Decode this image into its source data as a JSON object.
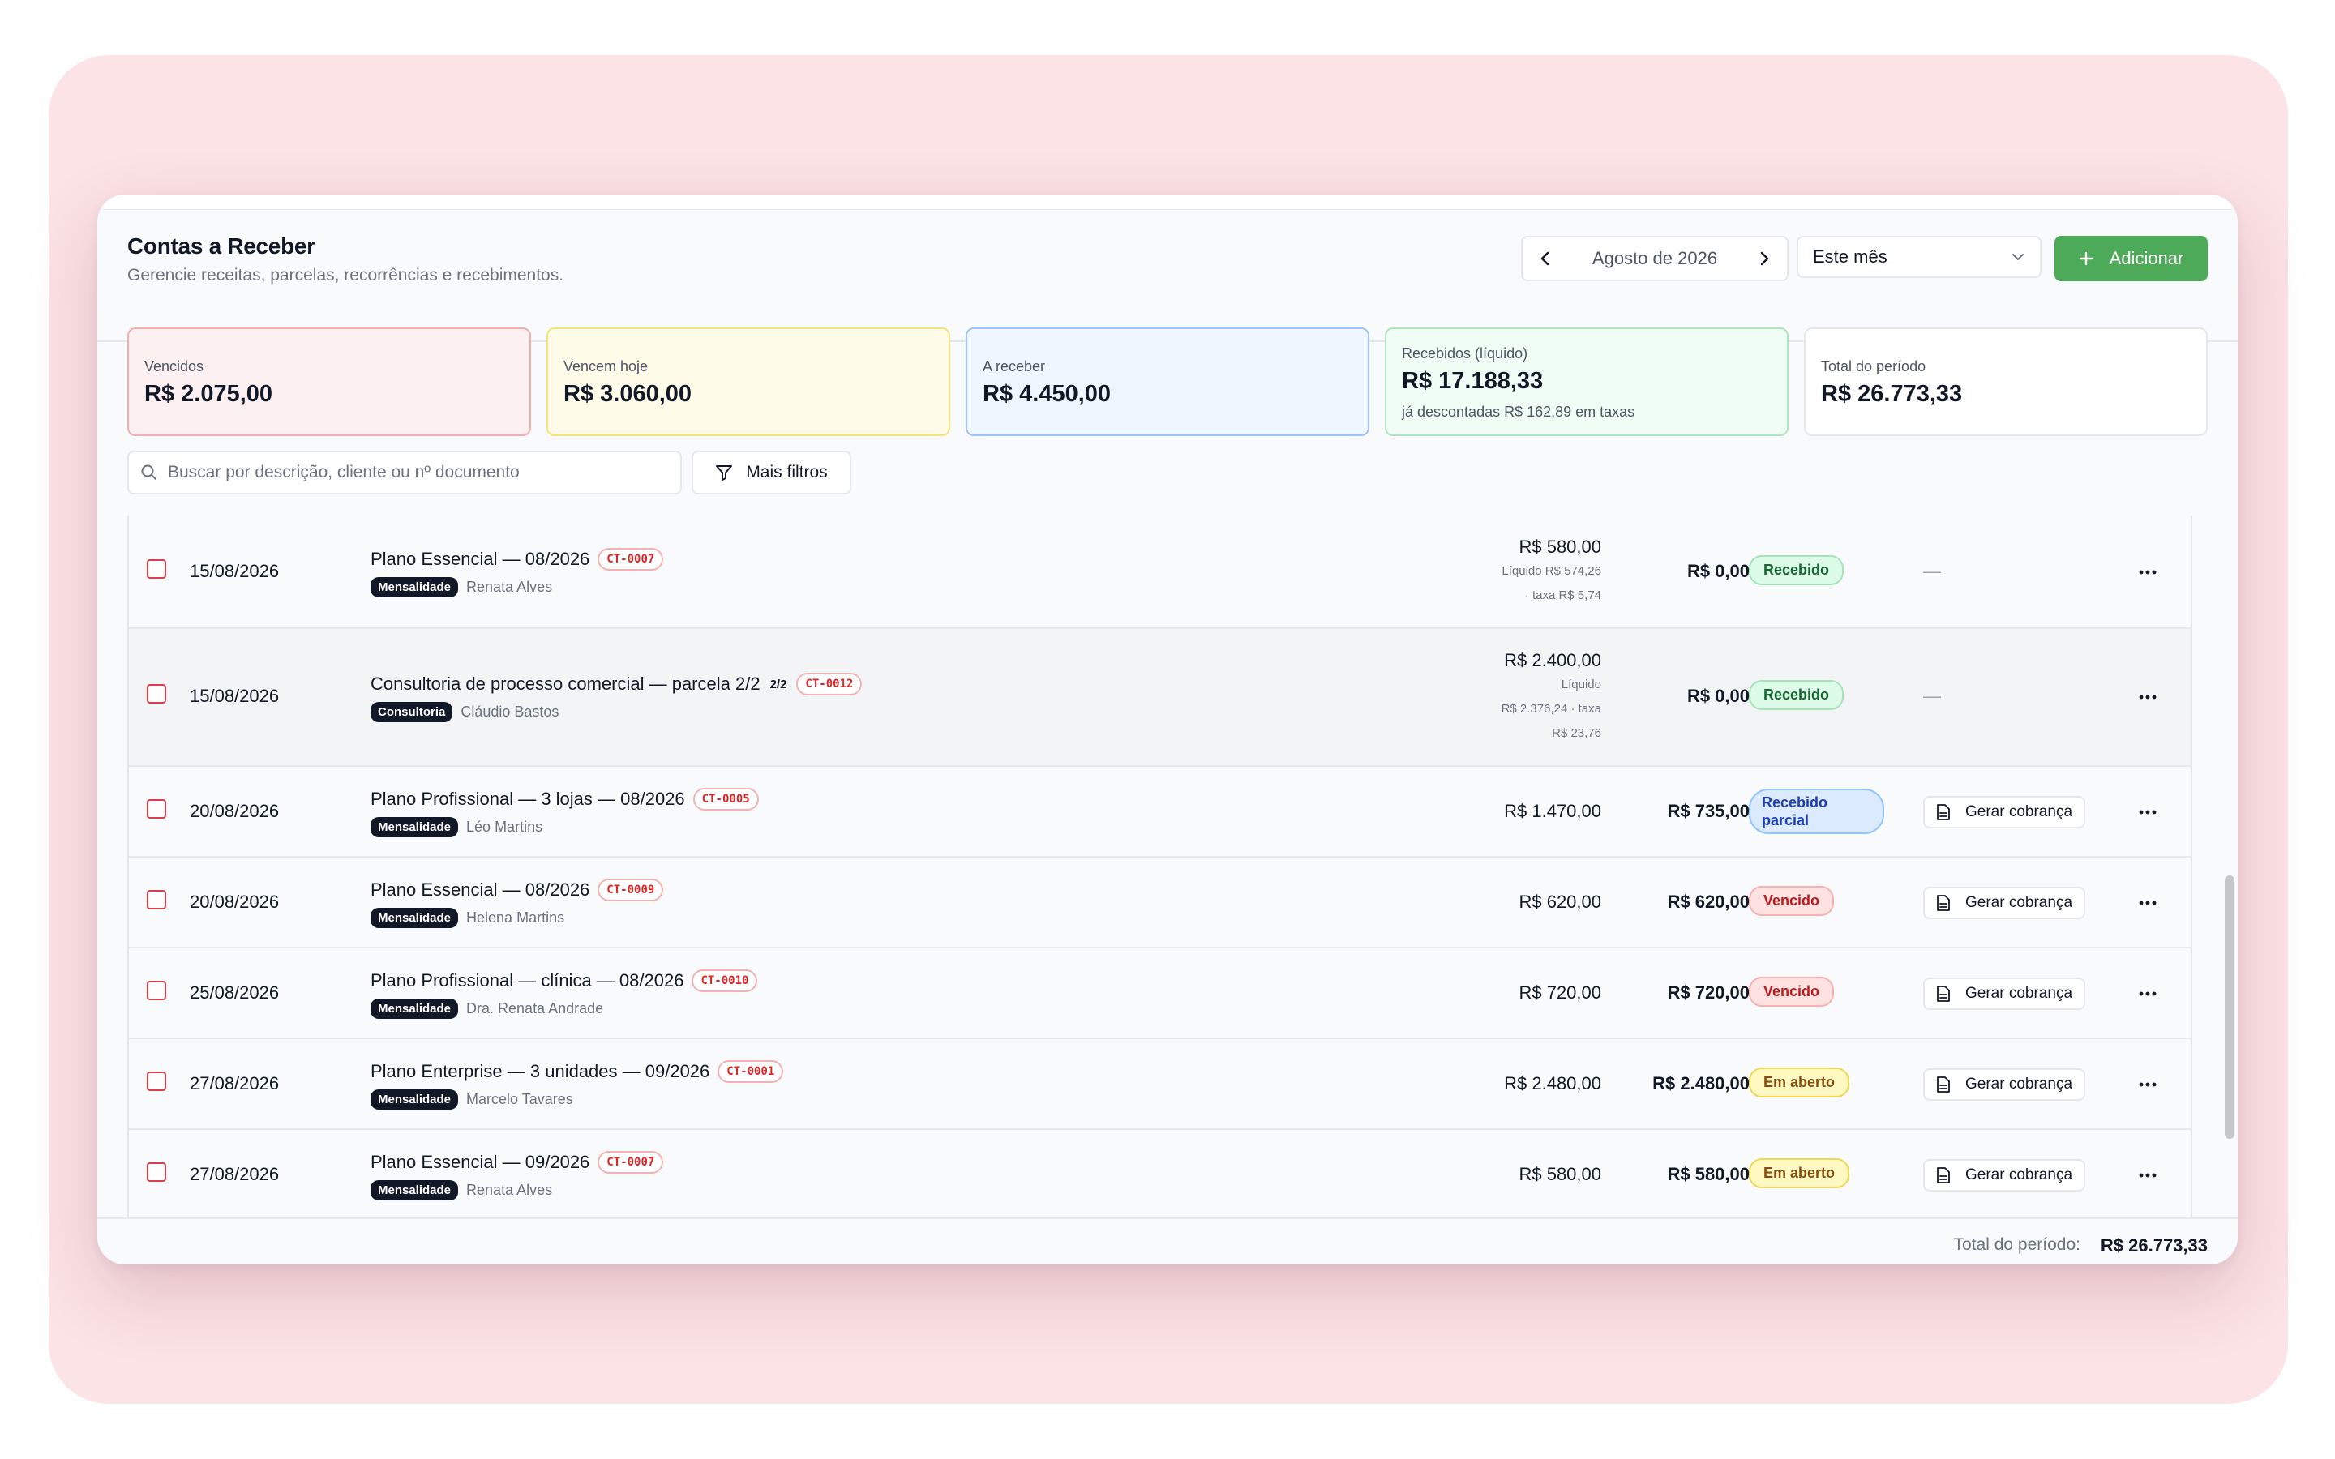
{
  "header": {
    "title": "Contas a Receber",
    "subtitle": "Gerencie receitas, parcelas, recorrências e recebimentos.",
    "period_label": "Agosto de 2026",
    "range_select": "Este mês",
    "add_button": "Adicionar"
  },
  "summary": {
    "overdue": {
      "label": "Vencidos",
      "value": "R$ 2.075,00"
    },
    "due_today": {
      "label": "Vencem hoje",
      "value": "R$ 3.060,00"
    },
    "to_receive": {
      "label": "A receber",
      "value": "R$ 4.450,00"
    },
    "received": {
      "label": "Recebidos (líquido)",
      "value": "R$ 17.188,33",
      "note": "já descontadas R$ 162,89 em taxas"
    },
    "total": {
      "label": "Total do período",
      "value": "R$ 26.773,33"
    }
  },
  "filters": {
    "search_placeholder": "Buscar por descrição, cliente ou nº documento",
    "more_filters": "Mais filtros"
  },
  "rows": [
    {
      "date": "15/08/2026",
      "description": "Plano Essencial — 08/2026",
      "code": "CT-0007",
      "category": "Mensalidade",
      "client": "Renata Alves",
      "amount": "R$ 580,00",
      "net_lines": [
        "Líquido R$ 574,26",
        "· taxa R$ 5,74"
      ],
      "open": "R$ 0,00",
      "status": "Recebido",
      "action": "—"
    },
    {
      "date": "15/08/2026",
      "description": "Consultoria de processo comercial — parcela 2/2",
      "installment": "2/2",
      "code": "CT-0012",
      "category": "Consultoria",
      "client": "Cláudio Bastos",
      "amount": "R$ 2.400,00",
      "net_lines": [
        "Líquido",
        "R$ 2.376,24 · taxa",
        "R$ 23,76"
      ],
      "open": "R$ 0,00",
      "status": "Recebido",
      "action": "—"
    },
    {
      "date": "20/08/2026",
      "description": "Plano Profissional — 3 lojas — 08/2026",
      "code": "CT-0005",
      "category": "Mensalidade",
      "client": "Léo Martins",
      "amount": "R$ 1.470,00",
      "open": "R$ 735,00",
      "status": "Recebido parcial",
      "action": "Gerar cobrança"
    },
    {
      "date": "20/08/2026",
      "description": "Plano Essencial — 08/2026",
      "code": "CT-0009",
      "category": "Mensalidade",
      "client": "Helena Martins",
      "amount": "R$ 620,00",
      "open": "R$ 620,00",
      "status": "Vencido",
      "action": "Gerar cobrança"
    },
    {
      "date": "25/08/2026",
      "description": "Plano Profissional — clínica — 08/2026",
      "code": "CT-0010",
      "category": "Mensalidade",
      "client": "Dra. Renata Andrade",
      "amount": "R$ 720,00",
      "open": "R$ 720,00",
      "status": "Vencido",
      "action": "Gerar cobrança"
    },
    {
      "date": "27/08/2026",
      "description": "Plano Enterprise — 3 unidades — 09/2026",
      "code": "CT-0001",
      "category": "Mensalidade",
      "client": "Marcelo Tavares",
      "amount": "R$ 2.480,00",
      "open": "R$ 2.480,00",
      "status": "Em aberto",
      "action": "Gerar cobrança"
    },
    {
      "date": "27/08/2026",
      "description": "Plano Essencial — 09/2026",
      "code": "CT-0007",
      "category": "Mensalidade",
      "client": "Renata Alves",
      "amount": "R$ 580,00",
      "open": "R$ 580,00",
      "status": "Em aberto",
      "action": "Gerar cobrança"
    }
  ],
  "footer": {
    "label": "Total do período:",
    "value": "R$ 26.773,33"
  },
  "colors": {
    "accent_green": "#4caa59",
    "overdue_bg": "#fdf0f0",
    "today_bg": "#fefbe9",
    "receive_bg": "#eff6ff",
    "received_bg": "#f0fdf4"
  }
}
